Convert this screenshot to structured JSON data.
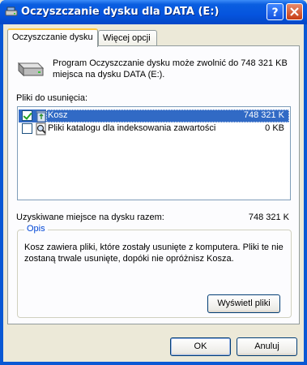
{
  "window": {
    "title": "Oczyszczanie dysku dla DATA (E:)"
  },
  "tabs": [
    {
      "label": "Oczyszczanie dysku",
      "active": true
    },
    {
      "label": "Więcej opcji",
      "active": false
    }
  ],
  "main": {
    "description": "Program Oczyszczanie dysku może zwolnić do 748 321 KB miejsca na dysku DATA (E:).",
    "files_label": "Pliki do usunięcia:",
    "files": [
      {
        "name": "Kosz",
        "size": "748 321 K",
        "checked": true,
        "selected": true,
        "icon": "recycle-bin-icon"
      },
      {
        "name": "Pliki katalogu dla indeksowania zawartości",
        "size": "0 KB",
        "checked": false,
        "selected": false,
        "icon": "search-catalog-icon"
      }
    ],
    "total_label": "Uzyskiwane miejsce na dysku razem:",
    "total_value": "748 321 K",
    "group": {
      "title": "Opis",
      "text": "Kosz zawiera pliki, które zostały usunięte z komputera. Pliki te nie zostaną trwale usunięte, dopóki nie opróżnisz Kosza.",
      "view_button": "Wyświetl pliki"
    }
  },
  "buttons": {
    "ok": "OK",
    "cancel": "Anuluj"
  }
}
